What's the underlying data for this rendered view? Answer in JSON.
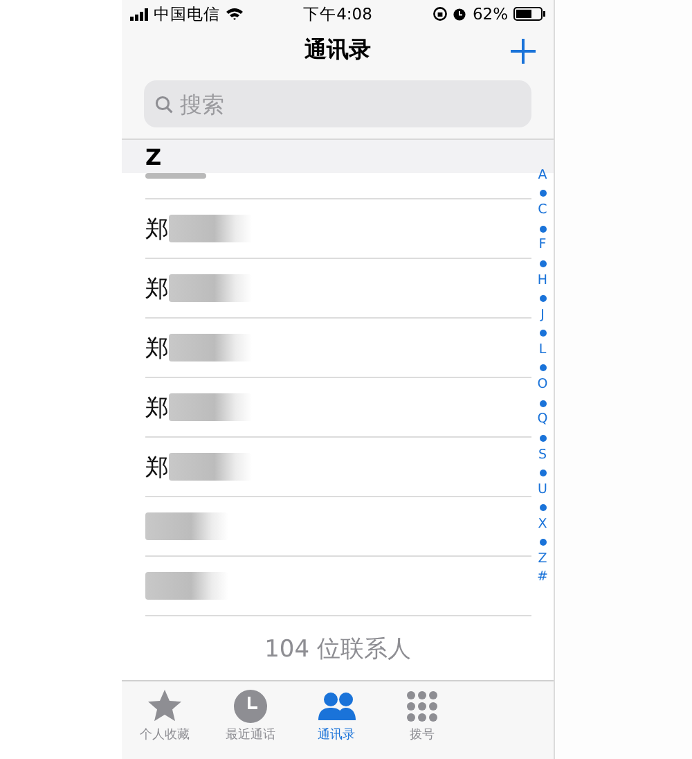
{
  "status_bar": {
    "carrier": "中国电信",
    "time": "下午4:08",
    "battery": "62%"
  },
  "nav": {
    "title": "通讯录"
  },
  "search": {
    "placeholder": "搜索"
  },
  "section": {
    "letter": "Z"
  },
  "contacts": [
    {
      "kind": "cut"
    },
    {
      "kind": "named",
      "name": "郑"
    },
    {
      "kind": "named",
      "name": "郑"
    },
    {
      "kind": "named",
      "name": "郑"
    },
    {
      "kind": "named",
      "name": "郑"
    },
    {
      "kind": "named",
      "name": "郑"
    },
    {
      "kind": "blurred"
    },
    {
      "kind": "blurred"
    }
  ],
  "index": [
    {
      "kind": "letter",
      "label": "A"
    },
    {
      "kind": "dot"
    },
    {
      "kind": "letter",
      "label": "C"
    },
    {
      "kind": "dot"
    },
    {
      "kind": "letter",
      "label": "F"
    },
    {
      "kind": "dot"
    },
    {
      "kind": "letter",
      "label": "H"
    },
    {
      "kind": "dot"
    },
    {
      "kind": "letter",
      "label": "J"
    },
    {
      "kind": "dot"
    },
    {
      "kind": "letter",
      "label": "L"
    },
    {
      "kind": "dot"
    },
    {
      "kind": "letter",
      "label": "O"
    },
    {
      "kind": "dot"
    },
    {
      "kind": "letter",
      "label": "Q"
    },
    {
      "kind": "dot"
    },
    {
      "kind": "letter",
      "label": "S"
    },
    {
      "kind": "dot"
    },
    {
      "kind": "letter",
      "label": "U"
    },
    {
      "kind": "dot"
    },
    {
      "kind": "letter",
      "label": "X"
    },
    {
      "kind": "dot"
    },
    {
      "kind": "letter",
      "label": "Z"
    },
    {
      "kind": "letter",
      "label": "#"
    }
  ],
  "footer": {
    "count": "104 位联系人"
  },
  "tabs": [
    {
      "kind": "star",
      "label": "个人收藏",
      "selected": false
    },
    {
      "kind": "clock",
      "label": "最近通话",
      "selected": false
    },
    {
      "kind": "people",
      "label": "通讯录",
      "selected": true
    },
    {
      "kind": "keypad",
      "label": "拨号",
      "selected": false
    }
  ]
}
